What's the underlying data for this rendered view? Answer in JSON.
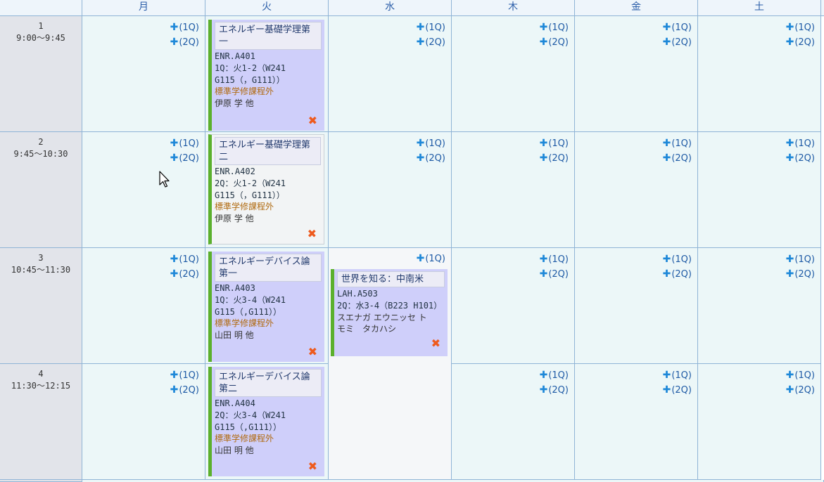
{
  "days": [
    "月",
    "火",
    "水",
    "木",
    "金",
    "土"
  ],
  "periods": [
    {
      "num": "1",
      "time": "9:00～9:45"
    },
    {
      "num": "2",
      "time": "9:45～10:30"
    },
    {
      "num": "3",
      "time": "10:45～11:30"
    },
    {
      "num": "4",
      "time": "11:30～12:15"
    }
  ],
  "add_links": {
    "q1": "(1Q)",
    "q2": "(2Q)"
  },
  "icons": {
    "add": "plus-icon",
    "remove": "close-x-icon"
  },
  "colors": {
    "accent_bar": "#5bb02d",
    "course_bg": "#cfcffa",
    "note": "#b06a10",
    "remove": "#ee5a1d"
  },
  "courses": [
    {
      "title": "エネルギー基礎学理第一",
      "code": "ENR.A401",
      "sched": "1Q：火1-2（W241",
      "room": "G115（，G111））",
      "note": "標準学修課程外",
      "instructor": "伊原 学 他"
    },
    {
      "title": "エネルギー基礎学理第二",
      "code": "ENR.A402",
      "sched": "2Q：火1-2（W241",
      "room": "G115（，G111））",
      "note": "標準学修課程外",
      "instructor": "伊原 学 他"
    },
    {
      "title": "エネルギーデバイス論第一",
      "code": "ENR.A403",
      "sched": "1Q：火3-4（W241",
      "room": "G115（,G111））",
      "note": "標準学修課程外",
      "instructor": "山田 明 他"
    },
    {
      "title": "エネルギーデバイス論第二",
      "code": "ENR.A404",
      "sched": "2Q：火3-4（W241",
      "room": "G115（,G111））",
      "note": "標準学修課程外",
      "instructor": "山田 明 他"
    },
    {
      "title": "世界を知る：中南米",
      "code": "LAH.A503",
      "sched": "2Q：水3-4（B223 H101）",
      "instructor": "スエナガ エウニッセ トモミ　タカハシ"
    }
  ]
}
